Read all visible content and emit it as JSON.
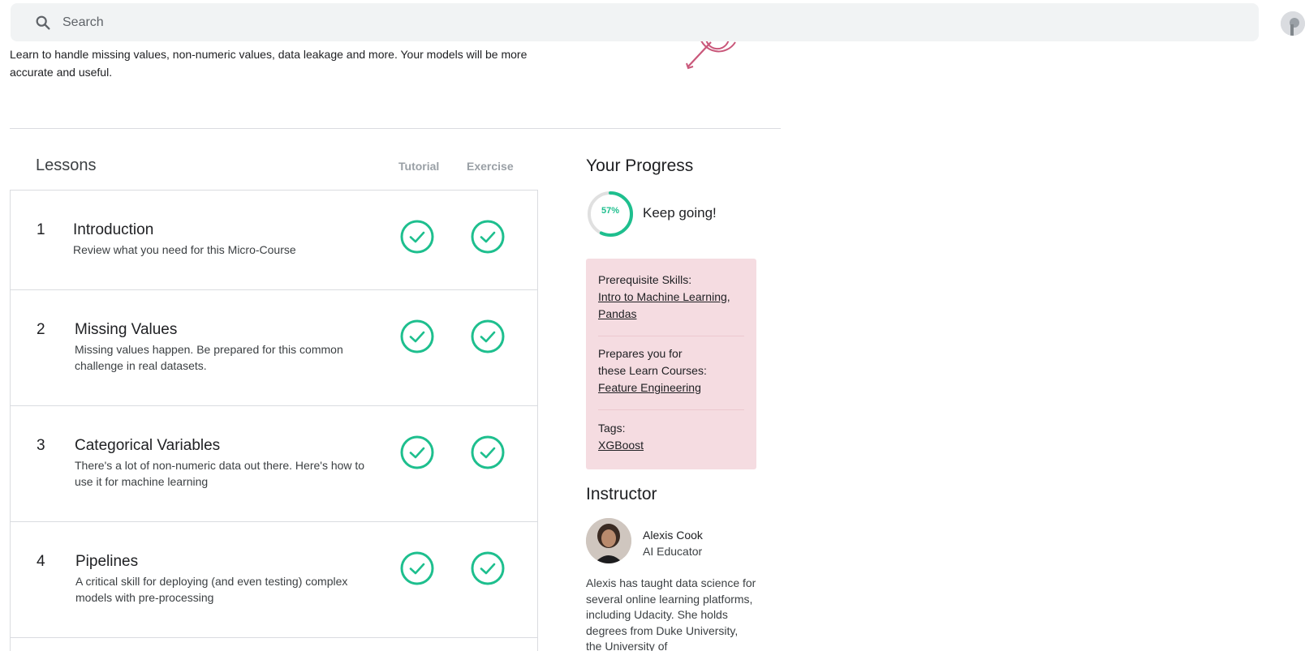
{
  "search": {
    "placeholder": "Search"
  },
  "course": {
    "description": "Learn to handle missing values, non-numeric values, data leakage and more. Your models will be more accurate and useful."
  },
  "lessons": {
    "title": "Lessons",
    "col_tutorial": "Tutorial",
    "col_exercise": "Exercise",
    "items": [
      {
        "num": "1",
        "title": "Introduction",
        "subtitle": "Review what you need for this Micro-Course",
        "tutorial_done": true,
        "exercise_done": true
      },
      {
        "num": "2",
        "title": "Missing Values",
        "subtitle": "Missing values happen. Be prepared for this common challenge in real datasets.",
        "tutorial_done": true,
        "exercise_done": true
      },
      {
        "num": "3",
        "title": "Categorical Variables",
        "subtitle": "There's a lot of non-numeric data out there. Here's how to use it for machine learning",
        "tutorial_done": true,
        "exercise_done": true
      },
      {
        "num": "4",
        "title": "Pipelines",
        "subtitle": "A critical skill for deploying (and even testing) complex models with pre-processing",
        "tutorial_done": true,
        "exercise_done": true
      }
    ]
  },
  "progress": {
    "title": "Your Progress",
    "percent_label": "57%",
    "percent_value": 0.57,
    "message": "Keep going!",
    "ring_color": "#20BEFF",
    "check_color": "#1EBF8E"
  },
  "info": {
    "prereq_label": "Prerequisite Skills:",
    "prereq_link1": "Intro to Machine Learning",
    "prereq_sep": ",",
    "prereq_link2": "Pandas",
    "prepares_line1": "Prepares you for",
    "prepares_line2": "these Learn Courses:",
    "prepares_link": "Feature Engineering",
    "tags_label": "Tags:",
    "tags_link": "XGBoost"
  },
  "instructor": {
    "title": "Instructor",
    "name": "Alexis Cook",
    "role": "AI Educator",
    "bio": "Alexis has taught data science for several online learning platforms, including Udacity. She holds degrees from Duke University, the University of"
  }
}
